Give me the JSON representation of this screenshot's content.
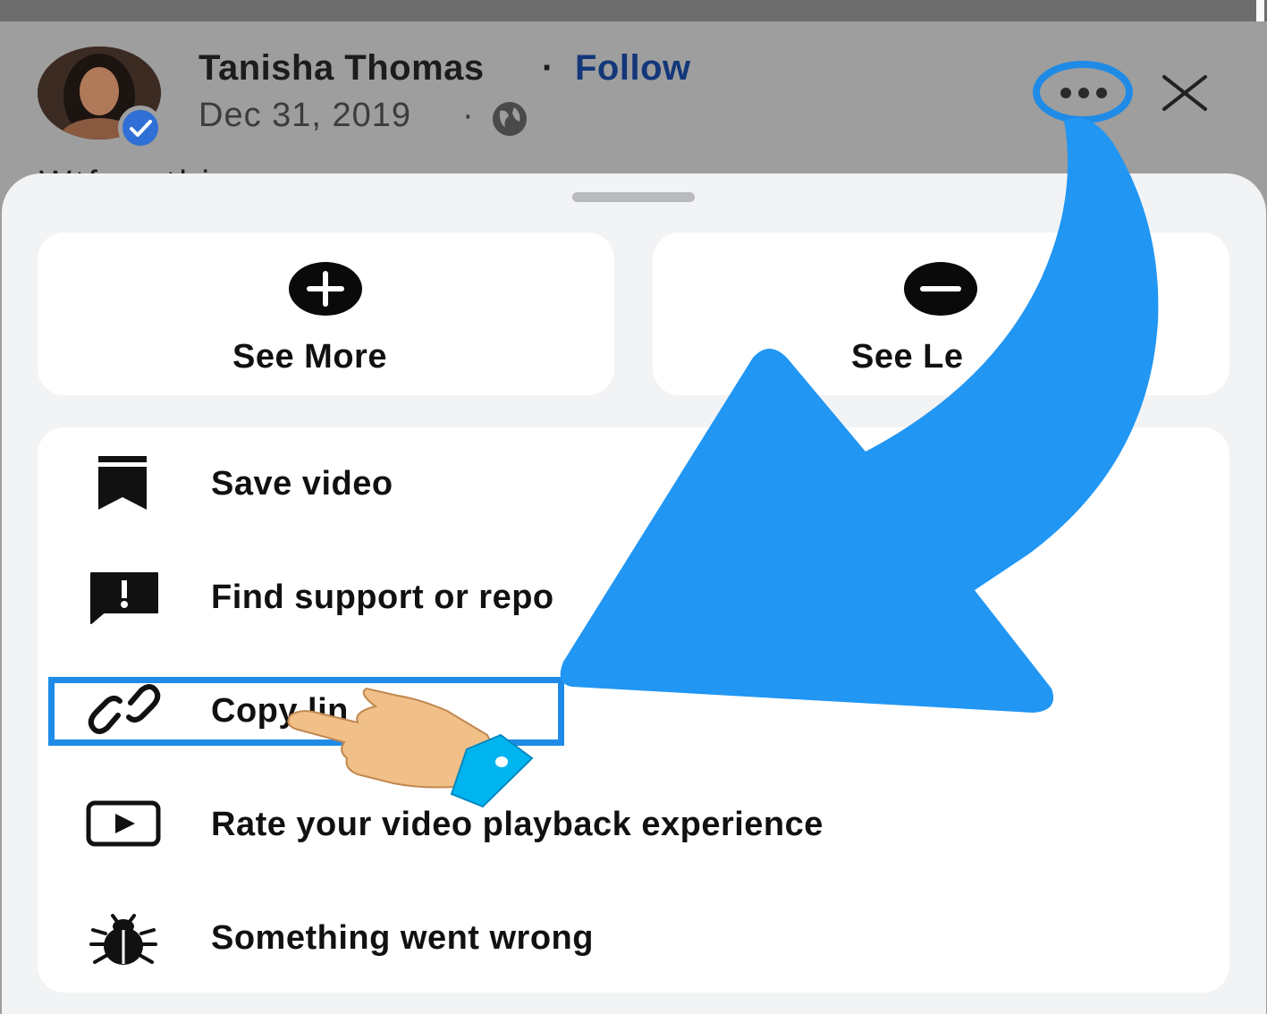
{
  "post": {
    "author": "Tanisha Thomas",
    "separator": "·",
    "follow_label": "Follow",
    "date": "Dec 31, 2019",
    "date_separator": "·",
    "caption_peek": "Wtf ... thi"
  },
  "sheet": {
    "see_more_label": "See More",
    "see_less_label": "See Le",
    "items": [
      {
        "label": "Save video",
        "icon": "bookmark-icon"
      },
      {
        "label": "Find support or repo",
        "icon": "report-icon"
      },
      {
        "label": "Copy lin",
        "icon": "link-icon"
      },
      {
        "label": "Rate your video playback experience",
        "icon": "play-icon"
      },
      {
        "label": "Something went wrong",
        "icon": "bug-icon"
      }
    ]
  },
  "colors": {
    "arrow": "#2196f3",
    "highlight": "#1f8be6",
    "follow": "#14377a"
  }
}
